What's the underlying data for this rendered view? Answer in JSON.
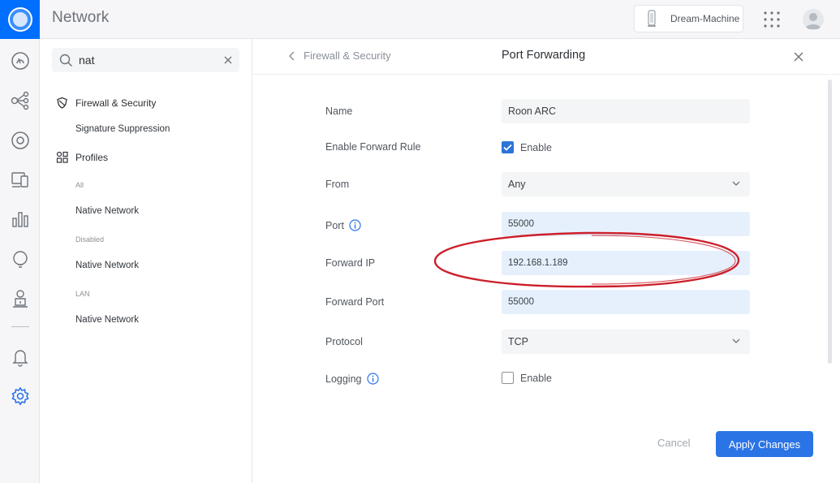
{
  "app": {
    "title": "Network"
  },
  "header": {
    "device_label": "Dream-Machine"
  },
  "search": {
    "value": "nat",
    "placeholder": ""
  },
  "sidepanel": {
    "items": [
      {
        "label": "Firewall & Security"
      },
      {
        "label": "Signature Suppression"
      },
      {
        "label": "Profiles"
      },
      {
        "label": "All"
      },
      {
        "label": "Native Network"
      },
      {
        "label": "Disabled"
      },
      {
        "label": "Native Network"
      },
      {
        "label": "LAN"
      },
      {
        "label": "Native Network"
      }
    ]
  },
  "page": {
    "back_label": "Firewall & Security",
    "title": "Port Forwarding"
  },
  "form": {
    "name": {
      "label": "Name",
      "value": "Roon ARC"
    },
    "enable_rule": {
      "label": "Enable Forward Rule",
      "checked": true,
      "option": "Enable"
    },
    "from": {
      "label": "From",
      "value": "Any"
    },
    "port": {
      "label": "Port",
      "value": "55000"
    },
    "forward_ip": {
      "label": "Forward IP",
      "value": "192.168.1.189"
    },
    "forward_port": {
      "label": "Forward Port",
      "value": "55000"
    },
    "protocol": {
      "label": "Protocol",
      "value": "TCP"
    },
    "logging": {
      "label": "Logging",
      "checked": false,
      "option": "Enable"
    }
  },
  "actions": {
    "cancel": "Cancel",
    "apply": "Apply Changes"
  },
  "colors": {
    "accent": "#006fff",
    "primary_button": "#2b74e6",
    "annotation": "#cc1f2a",
    "active_field": "#e6f0fd"
  }
}
